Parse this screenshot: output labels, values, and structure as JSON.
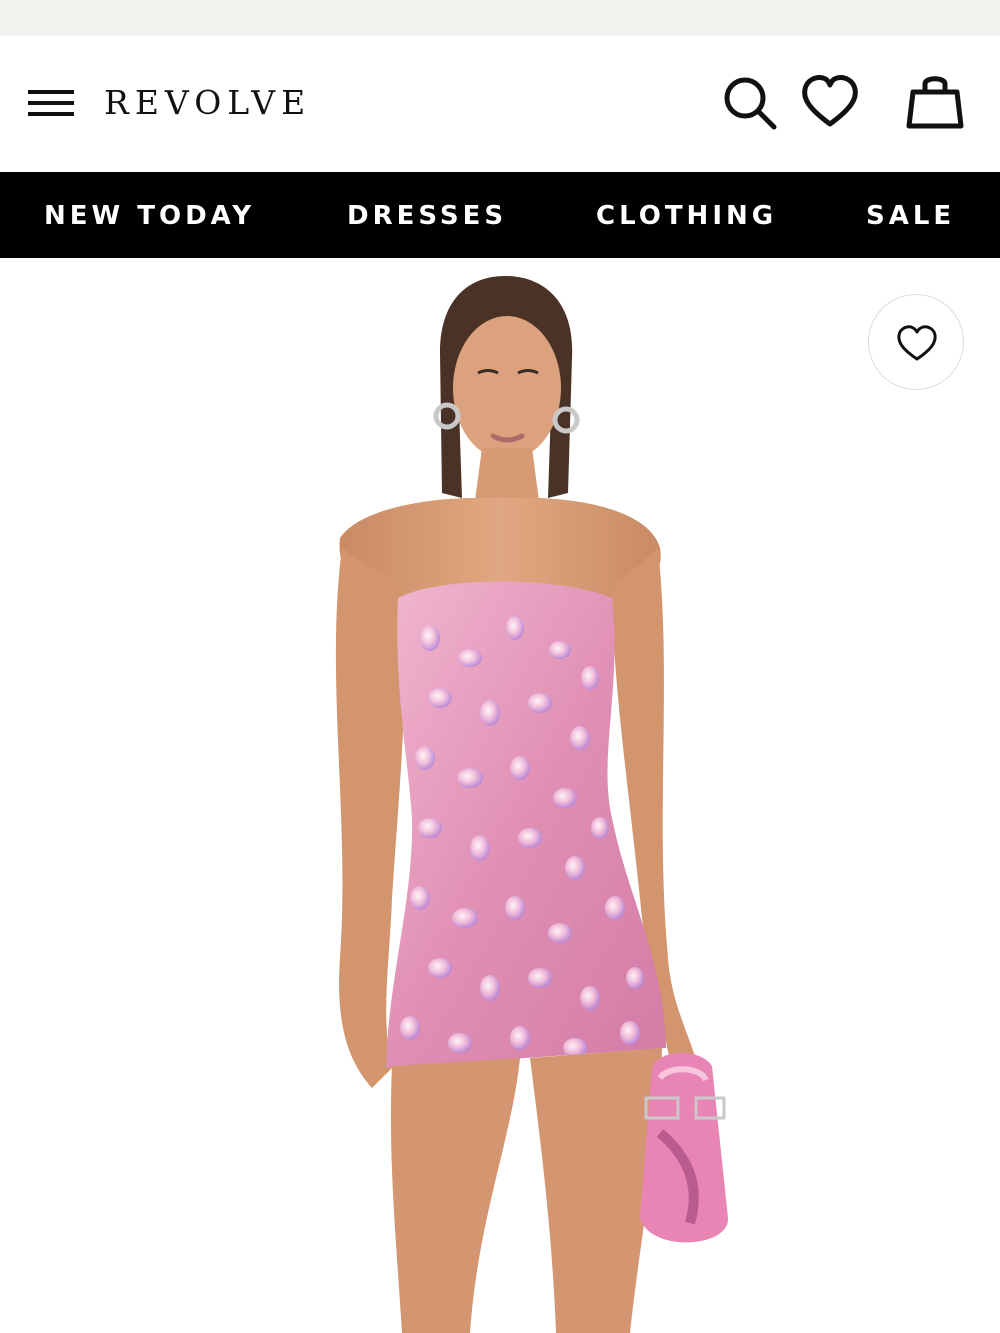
{
  "header": {
    "logo_text": "REVOLVE",
    "icons": [
      "menu-icon",
      "search-icon",
      "heart-icon",
      "shopping-bag-icon"
    ]
  },
  "nav": {
    "items": [
      {
        "label": "NEW TODAY"
      },
      {
        "label": "DRESSES"
      },
      {
        "label": "CLOTHING"
      },
      {
        "label": "SALE"
      }
    ]
  },
  "product": {
    "favorite_icon": "heart-icon",
    "colors": {
      "dress": "#e79bbd",
      "skin": "#d89a72",
      "hair": "#4a3326",
      "bag": "#e985b5"
    }
  },
  "theme": {
    "nav_background": "#000000",
    "nav_text": "#ffffff",
    "status_strip": "#f2f1ed"
  }
}
